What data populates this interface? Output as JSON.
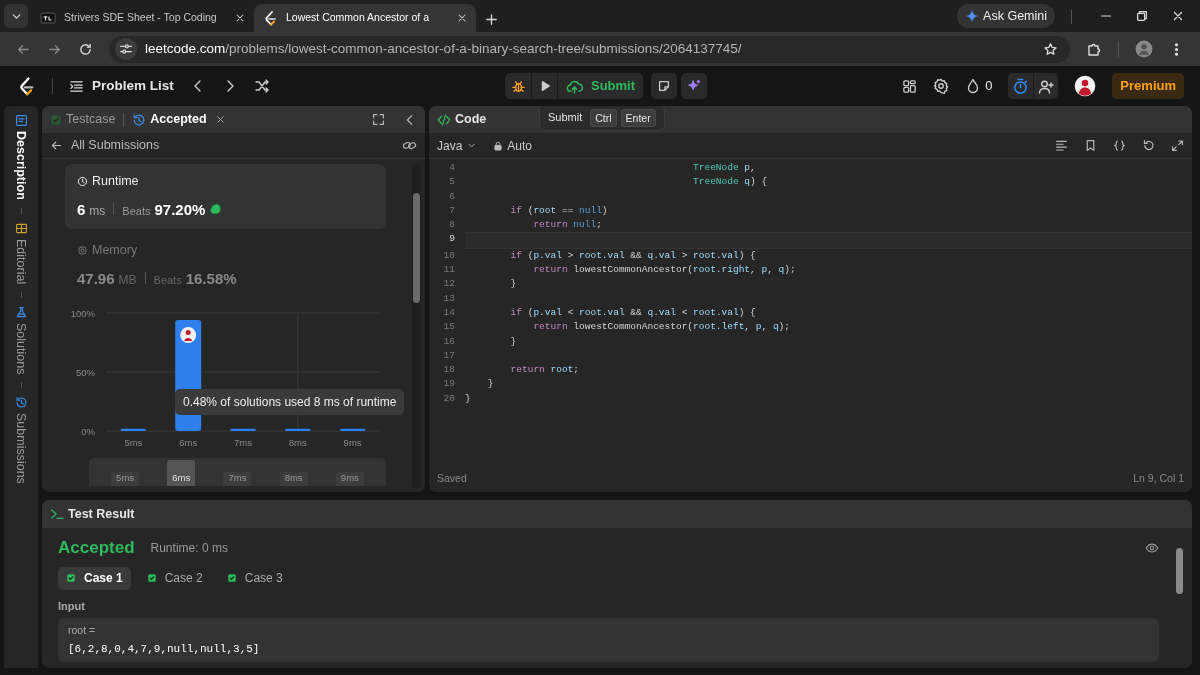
{
  "browser": {
    "tabs": [
      {
        "title": "Strivers SDE Sheet - Top Coding",
        "selected": false
      },
      {
        "title": "Lowest Common Ancestor of a",
        "selected": true
      }
    ],
    "gemini_button": "Ask Gemini",
    "url": {
      "host": "leetcode.com",
      "path": "/problems/lowest-common-ancestor-of-a-binary-search-tree/submissions/2064137745/"
    }
  },
  "navbar": {
    "problem_list": "Problem List",
    "submit": "Submit",
    "streak": "0",
    "premium": "Premium"
  },
  "shortcut_tooltip": {
    "label": "Submit",
    "keys": [
      "Ctrl",
      "Enter"
    ]
  },
  "sidebar": {
    "items": [
      {
        "kind": "description",
        "label": "Description",
        "selected": true
      },
      {
        "kind": "editorial",
        "label": "Editorial",
        "selected": false
      },
      {
        "kind": "solutions",
        "label": "Solutions",
        "selected": false
      },
      {
        "kind": "submissions",
        "label": "Submissions",
        "selected": false
      }
    ]
  },
  "submission_panel": {
    "tabs": [
      {
        "kind": "testcase",
        "label": "Testcase",
        "selected": false
      },
      {
        "kind": "result",
        "label": "Accepted",
        "selected": true
      }
    ],
    "back_link": "All Submissions",
    "stats": [
      {
        "kind": "runtime",
        "title": "Runtime",
        "value": "6",
        "unit": "ms",
        "beats_label": "Beats",
        "beats": "97.20%",
        "selected": true
      },
      {
        "kind": "memory",
        "title": "Memory",
        "value": "47.96",
        "unit": "MB",
        "beats_label": "Beats",
        "beats": "16.58%",
        "selected": false
      }
    ],
    "chart_data": {
      "type": "bar",
      "categories": [
        "5ms",
        "6ms",
        "7ms",
        "8ms",
        "9ms"
      ],
      "values": [
        2,
        94,
        2,
        2,
        2
      ],
      "ylim": [
        0,
        100
      ],
      "yticks": [
        {
          "value": 0,
          "label": "0%"
        },
        {
          "value": 50,
          "label": "50%"
        },
        {
          "value": 100,
          "label": "100%"
        }
      ]
    },
    "chart_tooltip": "0.48% of solutions used 8 ms of runtime",
    "range_labels": [
      {
        "label": "5ms",
        "selected": false
      },
      {
        "label": "6ms",
        "selected": true
      },
      {
        "label": "7ms",
        "selected": false
      },
      {
        "label": "8ms",
        "selected": false
      },
      {
        "label": "9ms",
        "selected": false
      }
    ]
  },
  "editor": {
    "title": "Code",
    "language": "Java",
    "mode": "Auto",
    "lines": [
      {
        "number": "4",
        "current": false,
        "tokens": [
          {
            "text": "                                        TreeNode",
            "kind": "type"
          },
          {
            "text": " p",
            "kind": "var"
          },
          {
            "text": ",",
            "kind": "plain"
          }
        ]
      },
      {
        "number": "5",
        "current": false,
        "tokens": [
          {
            "text": "                                        TreeNode",
            "kind": "type"
          },
          {
            "text": " q",
            "kind": "var"
          },
          {
            "text": ") {",
            "kind": "plain"
          }
        ]
      },
      {
        "number": "6",
        "current": false
      },
      {
        "number": "7",
        "current": false,
        "tokens": [
          {
            "text": "        if",
            "kind": "kw"
          },
          {
            "text": " (",
            "kind": "plain"
          },
          {
            "text": "root",
            "kind": "var"
          },
          {
            "text": " == ",
            "kind": "plain"
          },
          {
            "text": "null",
            "kind": "lit"
          },
          {
            "text": ")",
            "kind": "plain"
          }
        ]
      },
      {
        "number": "8",
        "current": false,
        "tokens": [
          {
            "text": "            return",
            "kind": "kw"
          },
          {
            "text": " null",
            "kind": "lit"
          },
          {
            "text": ";",
            "kind": "plain"
          }
        ]
      },
      {
        "number": "9",
        "current": true
      },
      {
        "number": "10",
        "current": false,
        "tokens": [
          {
            "text": "        if",
            "kind": "kw"
          },
          {
            "text": " (",
            "kind": "plain"
          },
          {
            "text": "p.val",
            "kind": "var"
          },
          {
            "text": " > ",
            "kind": "plain"
          },
          {
            "text": "root.val",
            "kind": "var"
          },
          {
            "text": " && ",
            "kind": "plain"
          },
          {
            "text": "q.val",
            "kind": "var"
          },
          {
            "text": " > ",
            "kind": "plain"
          },
          {
            "text": "root.val",
            "kind": "var"
          },
          {
            "text": ") {",
            "kind": "plain"
          }
        ]
      },
      {
        "number": "11",
        "current": false,
        "tokens": [
          {
            "text": "            return",
            "kind": "kw"
          },
          {
            "text": " lowestCommonAncestor(",
            "kind": "plain"
          },
          {
            "text": "root.right",
            "kind": "var"
          },
          {
            "text": ", ",
            "kind": "plain"
          },
          {
            "text": "p",
            "kind": "var"
          },
          {
            "text": ", ",
            "kind": "plain"
          },
          {
            "text": "q",
            "kind": "var"
          },
          {
            "text": ");",
            "kind": "plain"
          }
        ]
      },
      {
        "number": "12",
        "current": false,
        "tokens": [
          {
            "text": "        }",
            "kind": "plain"
          }
        ]
      },
      {
        "number": "13",
        "current": false
      },
      {
        "number": "14",
        "current": false,
        "tokens": [
          {
            "text": "        if",
            "kind": "kw"
          },
          {
            "text": " (",
            "kind": "plain"
          },
          {
            "text": "p.val",
            "kind": "var"
          },
          {
            "text": " < ",
            "kind": "plain"
          },
          {
            "text": "root.val",
            "kind": "var"
          },
          {
            "text": " && ",
            "kind": "plain"
          },
          {
            "text": "q.val",
            "kind": "var"
          },
          {
            "text": " < ",
            "kind": "plain"
          },
          {
            "text": "root.val",
            "kind": "var"
          },
          {
            "text": ") {",
            "kind": "plain"
          }
        ]
      },
      {
        "number": "15",
        "current": false,
        "tokens": [
          {
            "text": "            return",
            "kind": "kw"
          },
          {
            "text": " lowestCommonAncestor(",
            "kind": "plain"
          },
          {
            "text": "root.left",
            "kind": "var"
          },
          {
            "text": ", ",
            "kind": "plain"
          },
          {
            "text": "p",
            "kind": "var"
          },
          {
            "text": ", ",
            "kind": "plain"
          },
          {
            "text": "q",
            "kind": "var"
          },
          {
            "text": ");",
            "kind": "plain"
          }
        ]
      },
      {
        "number": "16",
        "current": false,
        "tokens": [
          {
            "text": "        }",
            "kind": "plain"
          }
        ]
      },
      {
        "number": "17",
        "current": false
      },
      {
        "number": "18",
        "current": false,
        "tokens": [
          {
            "text": "        return",
            "kind": "kw"
          },
          {
            "text": " root",
            "kind": "var"
          },
          {
            "text": ";",
            "kind": "plain"
          }
        ]
      },
      {
        "number": "19",
        "current": false,
        "tokens": [
          {
            "text": "    }",
            "kind": "plain"
          }
        ]
      },
      {
        "number": "20",
        "current": false,
        "tokens": [
          {
            "text": "}",
            "kind": "plain"
          }
        ]
      }
    ],
    "status": "Saved",
    "cursor": "Ln 9, Col 1"
  },
  "test_result": {
    "title": "Test Result",
    "verdict": "Accepted",
    "runtime": "Runtime: 0 ms",
    "cases": [
      {
        "label": "Case 1",
        "selected": true
      },
      {
        "label": "Case 2",
        "selected": false
      },
      {
        "label": "Case 3",
        "selected": false
      }
    ],
    "input_label": "Input",
    "inputs": [
      {
        "name": "root =",
        "value": "[6,2,8,0,4,7,9,null,null,3,5]"
      }
    ]
  }
}
